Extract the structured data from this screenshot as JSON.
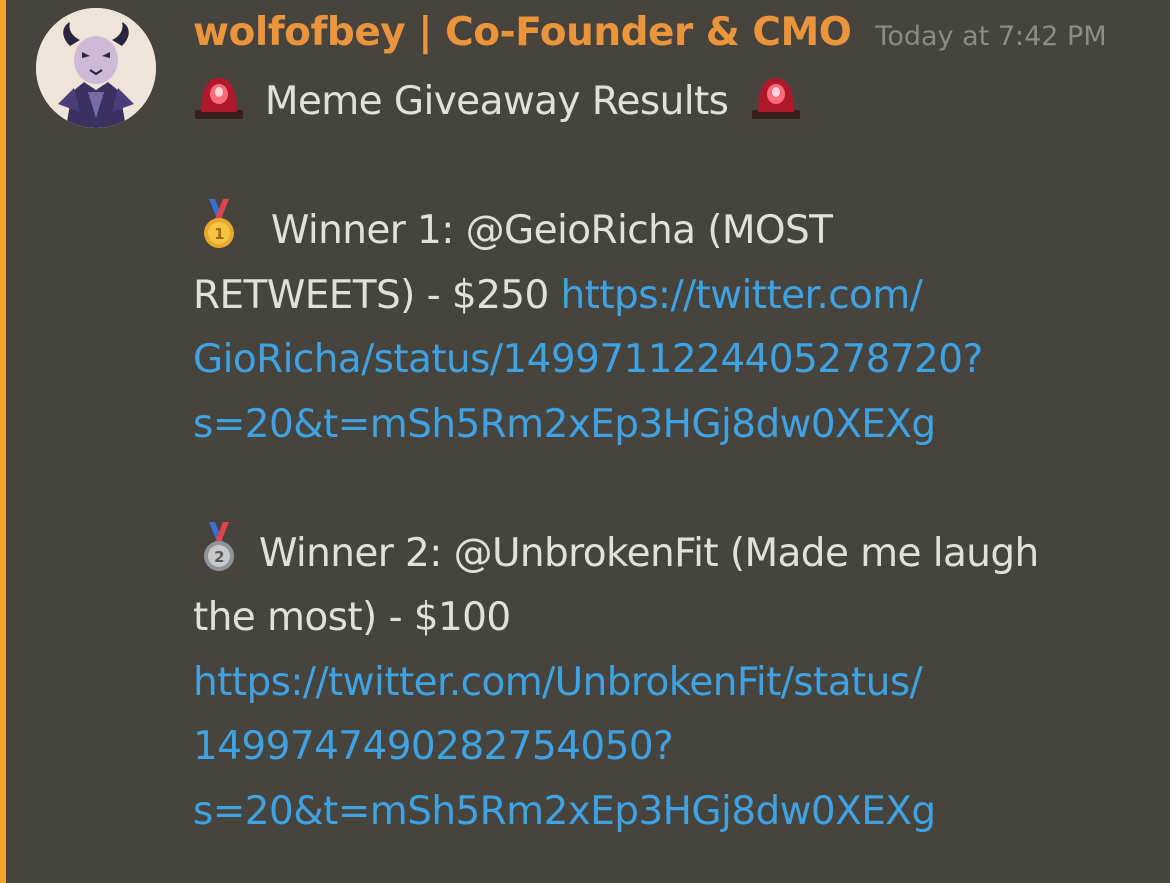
{
  "message": {
    "author": "wolfofbey | Co-Founder & CMO",
    "timestamp": "Today at 7:42 PM",
    "author_color": "#ea943c",
    "link_color": "#3ea2e3",
    "mention_bar_color": "#f2a33a",
    "avatar_icon": "horned-character-avatar",
    "title": "Meme Giveaway Results",
    "title_icons": [
      "rotating-light-icon",
      "rotating-light-icon"
    ],
    "winners": [
      {
        "icon": "first-place-medal-icon",
        "text_line1": "Winner 1: @GeioRicha (MOST",
        "text_line2": "RETWEETS) - $250",
        "link_lines": [
          "https://twitter.com/",
          "GioRicha/status/1499711224405278720?",
          "s=20&t=mSh5Rm2xEp3HGj8dw0XEXg"
        ]
      },
      {
        "icon": "second-place-medal-icon",
        "text_line1": "Winner 2: @UnbrokenFit (Made me laugh",
        "text_line2": "the most) - $100",
        "link_lines": [
          "https://twitter.com/UnbrokenFit/status/",
          "1499747490282754050?",
          "s=20&t=mSh5Rm2xEp3HGj8dw0XEXg"
        ]
      }
    ]
  }
}
